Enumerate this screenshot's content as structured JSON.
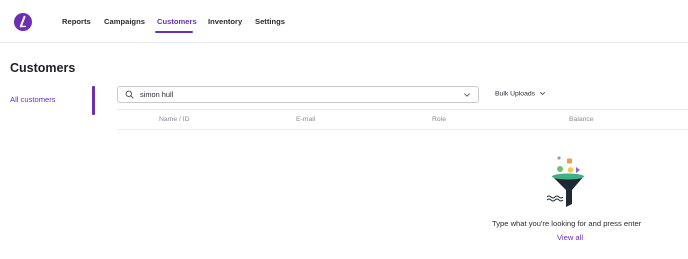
{
  "nav": {
    "items": [
      {
        "label": "Reports"
      },
      {
        "label": "Campaigns"
      },
      {
        "label": "Customers",
        "active": true
      },
      {
        "label": "Inventory"
      },
      {
        "label": "Settings"
      }
    ]
  },
  "page": {
    "title": "Customers"
  },
  "sidebar": {
    "items": [
      {
        "label": "All customers",
        "active": true
      }
    ]
  },
  "search": {
    "value": "simon hull"
  },
  "bulk_uploads": {
    "label": "Bulk Uploads"
  },
  "table": {
    "columns": [
      "Name / ID",
      "E-mail",
      "Role",
      "Balance"
    ]
  },
  "empty_state": {
    "message": "Type what you're looking for and press enter",
    "link": "View all"
  },
  "colors": {
    "accent": "#6b2fb3",
    "text": "#1f1f29",
    "muted": "#8b8b96",
    "border": "#c9c9d1"
  }
}
